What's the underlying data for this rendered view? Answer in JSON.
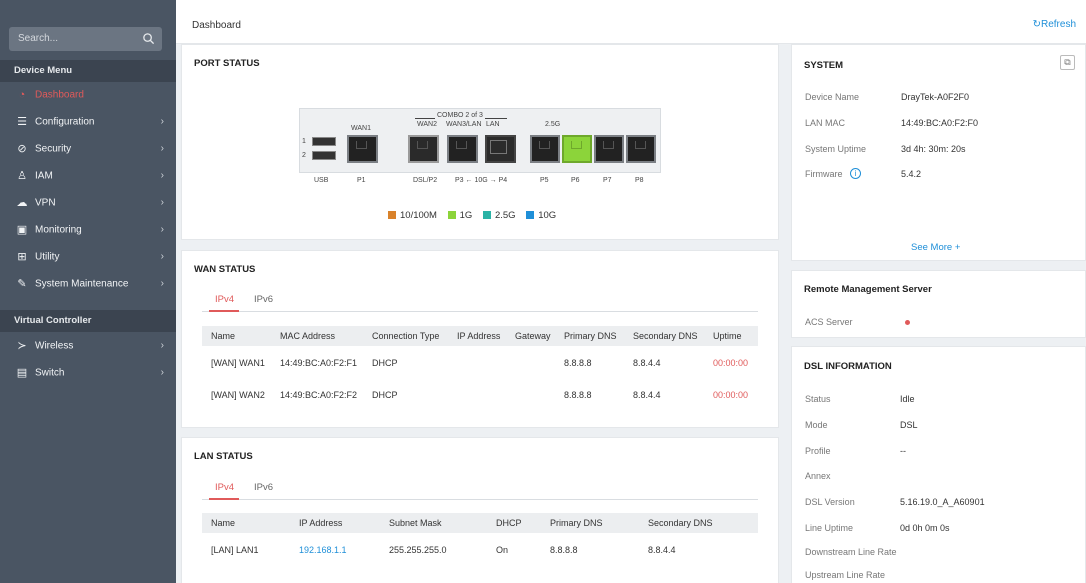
{
  "sidebar": {
    "search_placeholder": "Search...",
    "device_menu_label": "Device Menu",
    "virtual_controller_label": "Virtual Controller",
    "items": [
      {
        "label": "Dashboard",
        "icon": "dashboard-icon"
      },
      {
        "label": "Configuration",
        "icon": "sliders-icon"
      },
      {
        "label": "Security",
        "icon": "shield-icon"
      },
      {
        "label": "IAM",
        "icon": "users-icon"
      },
      {
        "label": "VPN",
        "icon": "cloud-icon"
      },
      {
        "label": "Monitoring",
        "icon": "monitor-icon"
      },
      {
        "label": "Utility",
        "icon": "grid-icon"
      },
      {
        "label": "System Maintenance",
        "icon": "wrench-icon"
      }
    ],
    "vc_items": [
      {
        "label": "Wireless",
        "icon": "wireless-icon"
      },
      {
        "label": "Switch",
        "icon": "switch-icon"
      }
    ]
  },
  "header": {
    "title": "Dashboard",
    "refresh_label": "Refresh"
  },
  "port_status": {
    "title": "PORT STATUS",
    "combo_label": "COMBO 2 of 3",
    "top_labels": {
      "wan1": "WAN1",
      "wan2": "WAN2",
      "wan3": "WAN3/LAN",
      "lan": "LAN",
      "g25": "2.5G"
    },
    "usb_nums": [
      "1",
      "2"
    ],
    "bottom_labels": {
      "usb": "USB",
      "p1": "P1",
      "dsl": "DSL/P2",
      "p3p4": "P3 ← 10G → P4",
      "p5": "P5",
      "p6": "P6",
      "p7": "P7",
      "p8": "P8"
    },
    "legend": [
      {
        "label": "10/100M",
        "color": "#d9822b"
      },
      {
        "label": "1G",
        "color": "#8cd43a"
      },
      {
        "label": "2.5G",
        "color": "#2ab3a6"
      },
      {
        "label": "10G",
        "color": "#1f8fd8"
      }
    ]
  },
  "wan_status": {
    "title": "WAN STATUS",
    "tabs": [
      "IPv4",
      "IPv6"
    ],
    "columns": [
      "Name",
      "MAC Address",
      "Connection Type",
      "IP Address",
      "Gateway",
      "Primary DNS",
      "Secondary DNS",
      "Uptime"
    ],
    "rows": [
      [
        "[WAN] WAN1",
        "14:49:BC:A0:F2:F1",
        "DHCP",
        "",
        "",
        "8.8.8.8",
        "8.8.4.4",
        "00:00:00"
      ],
      [
        "[WAN] WAN2",
        "14:49:BC:A0:F2:F2",
        "DHCP",
        "",
        "",
        "8.8.8.8",
        "8.8.4.4",
        "00:00:00"
      ]
    ]
  },
  "lan_status": {
    "title": "LAN STATUS",
    "tabs": [
      "IPv4",
      "IPv6"
    ],
    "columns": [
      "Name",
      "IP Address",
      "Subnet Mask",
      "DHCP",
      "Primary DNS",
      "Secondary DNS"
    ],
    "rows": [
      [
        "[LAN] LAN1",
        "192.168.1.1",
        "255.255.255.0",
        "On",
        "8.8.8.8",
        "8.8.4.4"
      ]
    ]
  },
  "system": {
    "title": "SYSTEM",
    "fields": [
      {
        "key": "Device Name",
        "value": "DrayTek-A0F2F0"
      },
      {
        "key": "LAN MAC",
        "value": "14:49:BC:A0:F2:F0"
      },
      {
        "key": "System Uptime",
        "value": "3d 4h: 30m: 20s"
      },
      {
        "key": "Firmware",
        "value": "5.4.2"
      }
    ],
    "see_more": "See More +"
  },
  "remote_mgmt": {
    "title": "Remote Management Server",
    "acs_label": "ACS Server",
    "status_color": "#e05a5a"
  },
  "dsl": {
    "title": "DSL INFORMATION",
    "fields": [
      {
        "key": "Status",
        "value": "Idle"
      },
      {
        "key": "Mode",
        "value": "DSL"
      },
      {
        "key": "Profile",
        "value": "--"
      },
      {
        "key": "Annex",
        "value": ""
      },
      {
        "key": "DSL Version",
        "value": "5.16.19.0_A_A60901"
      },
      {
        "key": "Line Uptime",
        "value": "0d 0h 0m 0s"
      },
      {
        "key": "Downstream Line Rate",
        "value": ""
      },
      {
        "key": "Upstream Line Rate",
        "value": ""
      }
    ]
  }
}
